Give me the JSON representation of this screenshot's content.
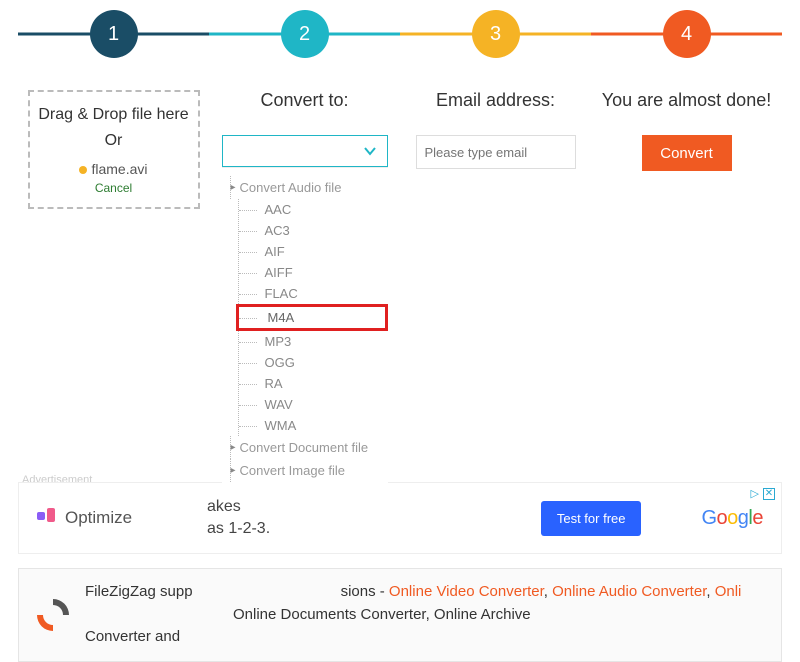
{
  "steps": {
    "s1": "1",
    "s2": "2",
    "s3": "3",
    "s4": "4"
  },
  "dropzone": {
    "line1": "Drag & Drop file here",
    "or": "Or",
    "filename": "flame.avi",
    "cancel": "Cancel"
  },
  "headings": {
    "convert": "Convert to:",
    "email": "Email address:",
    "done": "You are almost done!"
  },
  "email": {
    "placeholder": "Please type email"
  },
  "convert_btn": "Convert",
  "dropdown": {
    "group_audio": "Convert Audio file",
    "audio": {
      "aac": "AAC",
      "ac3": "AC3",
      "aif": "AIF",
      "aiff": "AIFF",
      "flac": "FLAC",
      "m4a": "M4A",
      "mp3": "MP3",
      "ogg": "OGG",
      "ra": "RA",
      "wav": "WAV",
      "wma": "WMA"
    },
    "group_doc": "Convert Document file",
    "group_img": "Convert Image file"
  },
  "ad": {
    "label": "Advertisement",
    "optimize": "Optimize",
    "mid1": "akes",
    "mid2": "as 1-2-3.",
    "test": "Test for free",
    "close_tri": "▷"
  },
  "bottom": {
    "pre": "FileZigZag supp",
    "mid": "sions - ",
    "l1": "Online Video Converter",
    "sep1": ", ",
    "l2": "Online Audio Converter",
    "sep2": ", ",
    "l3": "Onli",
    "tail1": "Online Documents Converter, Online Archive",
    "tail2": "Converter and "
  }
}
